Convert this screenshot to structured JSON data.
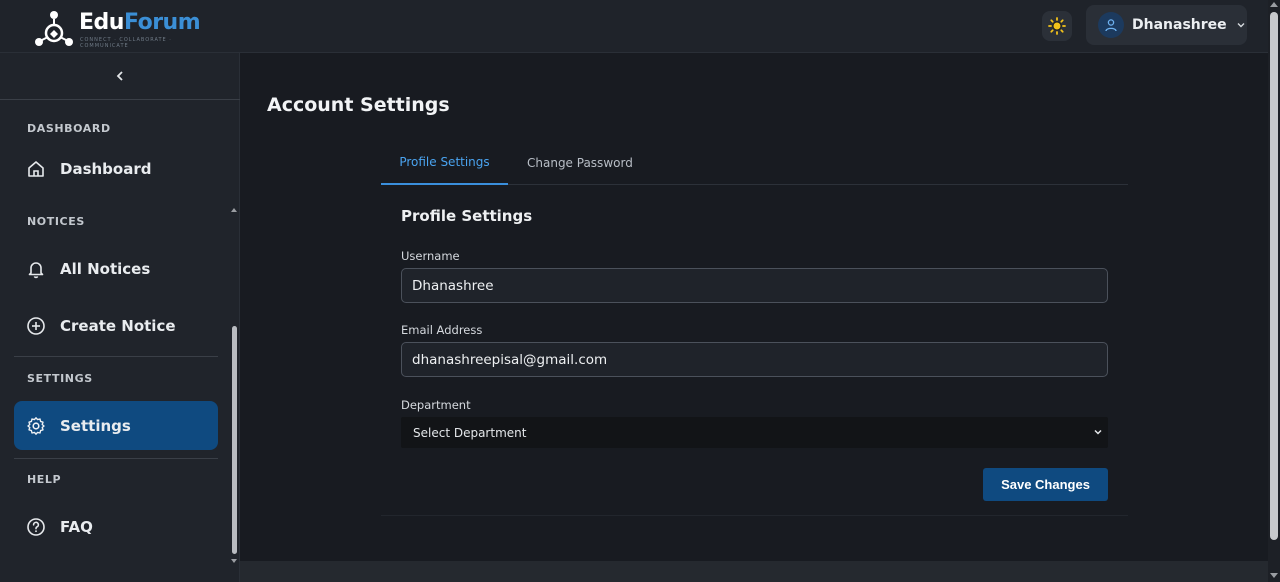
{
  "header": {
    "logo": {
      "word1": "Edu",
      "word2": "Forum",
      "tagline": "CONNECT · COLLABORATE · COMMUNICATE"
    },
    "theme_icon": "sun-icon",
    "user": {
      "name": "Dhanashree",
      "avatar_icon": "user-icon",
      "chevron_icon": "chevron-down-icon"
    }
  },
  "sidebar": {
    "collapse_icon": "chevron-left-icon",
    "sections": {
      "dashboard": "DASHBOARD",
      "notices": "NOTICES",
      "settings": "SETTINGS",
      "help": "HELP"
    },
    "items": [
      {
        "label": "Dashboard",
        "icon": "home-icon"
      },
      {
        "label": "All Notices",
        "icon": "bell-icon"
      },
      {
        "label": "Create Notice",
        "icon": "plus-circle-icon"
      },
      {
        "label": "Settings",
        "icon": "gear-icon",
        "active": true
      },
      {
        "label": "FAQ",
        "icon": "question-circle-icon"
      }
    ]
  },
  "main": {
    "title": "Account Settings",
    "tabs": [
      {
        "label": "Profile Settings",
        "active": true
      },
      {
        "label": "Change Password",
        "active": false
      }
    ],
    "form": {
      "section_title": "Profile Settings",
      "username_label": "Username",
      "username_value": "Dhanashree",
      "email_label": "Email Address",
      "email_value": "dhanashreepisal@gmail.com",
      "department_label": "Department",
      "department_value": "Select Department",
      "save_label": "Save Changes"
    }
  },
  "colors": {
    "accent": "#0f4a80",
    "link": "#4aa3ef",
    "background": "#181b21",
    "sidebar": "#20242b"
  }
}
